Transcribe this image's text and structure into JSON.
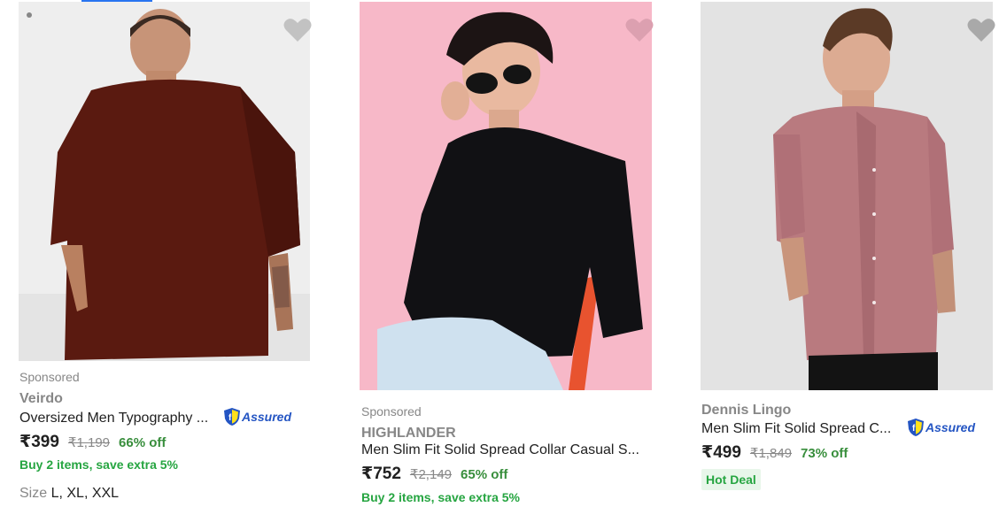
{
  "products": [
    {
      "sponsored": "Sponsored",
      "brand": "Veirdo",
      "title": "Oversized Men Typography ...",
      "assured": "Assured",
      "price": "₹399",
      "mrp": "₹1,199",
      "discount": "66% off",
      "offer": "Buy 2 items, save extra 5%",
      "size_label": "Size",
      "sizes": "L, XL, XXL",
      "wishlist_icon": "heart-icon",
      "image_desc": "brown-oversized-tshirt"
    },
    {
      "sponsored": "Sponsored",
      "brand": "HIGHLANDER",
      "title": "Men Slim Fit Solid Spread Collar Casual S...",
      "price": "₹752",
      "mrp": "₹2,149",
      "discount": "65% off",
      "offer": "Buy 2 items, save extra 5%",
      "wishlist_icon": "heart-icon",
      "image_desc": "black-shirt-pink-background"
    },
    {
      "brand": "Dennis Lingo",
      "title": "Men Slim Fit Solid Spread C...",
      "assured": "Assured",
      "price": "₹499",
      "mrp": "₹1,849",
      "discount": "73% off",
      "badge": "Hot Deal",
      "wishlist_icon": "heart-icon",
      "image_desc": "mauve-pink-shirt"
    }
  ],
  "colors": {
    "accent": "#2874f0",
    "discount_green": "#388e3c",
    "offer_green": "#26a541",
    "muted": "#878787",
    "assured_blue": "#2455c3"
  }
}
